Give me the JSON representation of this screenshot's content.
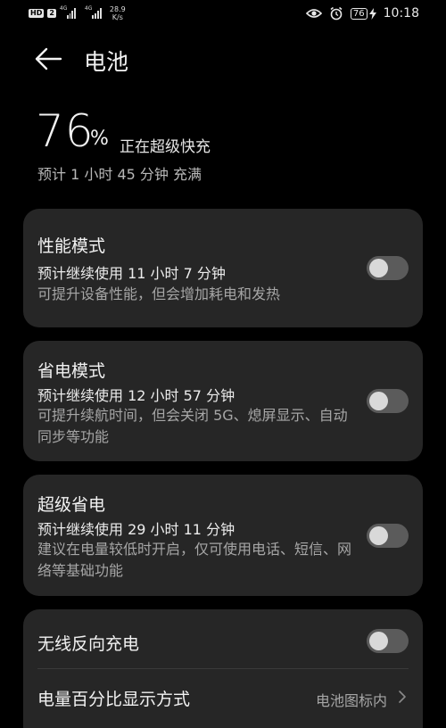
{
  "status_bar": {
    "badge_hd": "HD",
    "badge_2": "2",
    "sig1_tag": "4G",
    "sig2_tag": "4G",
    "speed_value": "28.9",
    "speed_unit": "K/s",
    "battery_level": "76",
    "time": "10:18"
  },
  "header": {
    "title": "电池"
  },
  "battery": {
    "percent": "76",
    "percent_sign": "%",
    "status": "正在超级快充",
    "full_estimate": "预计 1 小时 45 分钟 充满"
  },
  "modes": [
    {
      "title": "性能模式",
      "usage": "预计继续使用 11 小时 7 分钟",
      "description": "可提升设备性能，但会增加耗电和发热",
      "enabled": false
    },
    {
      "title": "省电模式",
      "usage": "预计继续使用 12 小时 57 分钟",
      "description": "可提升续航时间，但会关闭 5G、熄屏显示、自动同步等功能",
      "enabled": false
    },
    {
      "title": "超级省电",
      "usage": "预计继续使用 29 小时 11 分钟",
      "description": "建议在电量较低时开启，仅可使用电话、短信、网络等基础功能",
      "enabled": false
    }
  ],
  "settings": {
    "wireless_reverse_label": "无线反向充电",
    "wireless_reverse_enabled": false,
    "percent_display_label": "电量百分比显示方式",
    "percent_display_value": "电池图标内"
  },
  "colors": {
    "background": "#000000",
    "card": "#262626",
    "toggle_off_track": "#5b5b5b",
    "toggle_knob": "#d9d9d9",
    "secondary_text": "#a6a6a6"
  }
}
